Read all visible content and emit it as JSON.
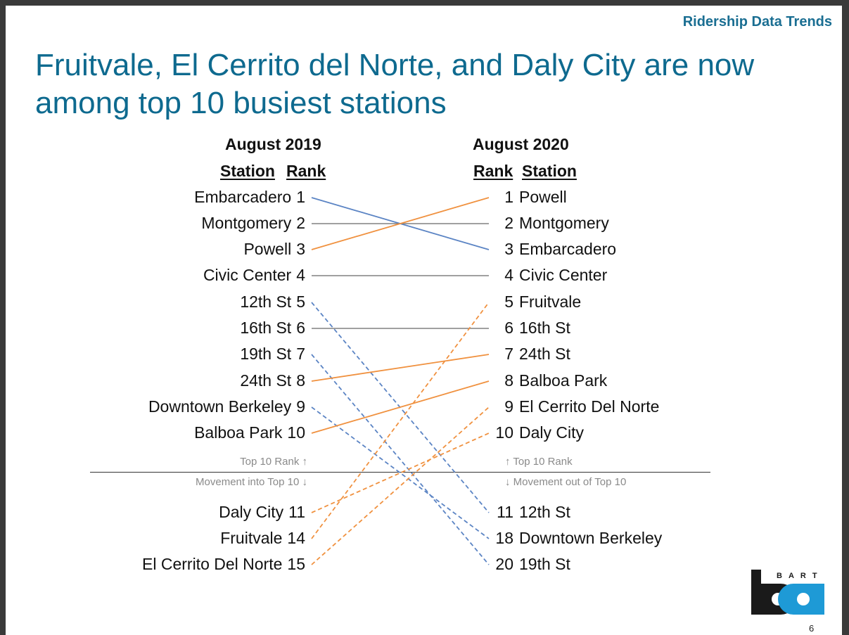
{
  "header": {
    "section_tag": "Ridership Data Trends",
    "title": "Fruitvale, El Cerrito del Norte, and Daly City are now among top 10 busiest stations"
  },
  "footer": {
    "logo_text": "BART",
    "page_number": "6"
  },
  "colors": {
    "title": "#0e6a8f",
    "up": "#f0913f",
    "down": "#5b84c4",
    "same": "#808080",
    "logo_black": "#1a1a1a",
    "logo_blue": "#1e9ad6"
  },
  "chart_data": {
    "type": "slope",
    "title": "Fruitvale, El Cerrito del Norte, and Daly City are now among top 10 busiest stations",
    "left": {
      "year_label": "August 2019",
      "station_header": "Station",
      "rank_header": "Rank",
      "rows": [
        {
          "station": "Embarcadero",
          "rank": "1"
        },
        {
          "station": "Montgomery",
          "rank": "2"
        },
        {
          "station": "Powell",
          "rank": "3"
        },
        {
          "station": "Civic Center",
          "rank": "4"
        },
        {
          "station": "12th St",
          "rank": "5"
        },
        {
          "station": "16th St",
          "rank": "6"
        },
        {
          "station": "19th St",
          "rank": "7"
        },
        {
          "station": "24th St",
          "rank": "8"
        },
        {
          "station": "Downtown Berkeley",
          "rank": "9"
        },
        {
          "station": "Balboa Park",
          "rank": "10"
        },
        {
          "station": "Daly City",
          "rank": "11"
        },
        {
          "station": "Fruitvale",
          "rank": "14"
        },
        {
          "station": "El Cerrito Del Norte",
          "rank": "15"
        }
      ],
      "note_top": "Top 10 Rank ↑",
      "note_bottom": "Movement into Top 10 ↓"
    },
    "right": {
      "year_label": "August 2020",
      "rank_header": "Rank",
      "station_header": "Station",
      "rows": [
        {
          "rank": "1",
          "station": "Powell"
        },
        {
          "rank": "2",
          "station": "Montgomery"
        },
        {
          "rank": "3",
          "station": "Embarcadero"
        },
        {
          "rank": "4",
          "station": "Civic Center"
        },
        {
          "rank": "5",
          "station": "Fruitvale"
        },
        {
          "rank": "6",
          "station": "16th St"
        },
        {
          "rank": "7",
          "station": "24th St"
        },
        {
          "rank": "8",
          "station": "Balboa Park"
        },
        {
          "rank": "9",
          "station": "El Cerrito Del Norte"
        },
        {
          "rank": "10",
          "station": "Daly City"
        },
        {
          "rank": "11",
          "station": "12th St"
        },
        {
          "rank": "18",
          "station": "Downtown Berkeley"
        },
        {
          "rank": "20",
          "station": "19th St"
        }
      ],
      "note_top": "↑ Top 10 Rank",
      "note_bottom": "↓ Movement out of Top 10"
    },
    "links": [
      {
        "station": "Embarcadero",
        "rank_2019": 1,
        "rank_2020": 3,
        "direction": "down",
        "style": "solid"
      },
      {
        "station": "Montgomery",
        "rank_2019": 2,
        "rank_2020": 2,
        "direction": "same",
        "style": "solid"
      },
      {
        "station": "Powell",
        "rank_2019": 3,
        "rank_2020": 1,
        "direction": "up",
        "style": "solid"
      },
      {
        "station": "Civic Center",
        "rank_2019": 4,
        "rank_2020": 4,
        "direction": "same",
        "style": "solid"
      },
      {
        "station": "12th St",
        "rank_2019": 5,
        "rank_2020": 11,
        "direction": "down",
        "style": "dashed"
      },
      {
        "station": "16th St",
        "rank_2019": 6,
        "rank_2020": 6,
        "direction": "same",
        "style": "solid"
      },
      {
        "station": "19th St",
        "rank_2019": 7,
        "rank_2020": 20,
        "direction": "down",
        "style": "dashed"
      },
      {
        "station": "24th St",
        "rank_2019": 8,
        "rank_2020": 7,
        "direction": "up",
        "style": "solid"
      },
      {
        "station": "Downtown Berkeley",
        "rank_2019": 9,
        "rank_2020": 18,
        "direction": "down",
        "style": "dashed"
      },
      {
        "station": "Balboa Park",
        "rank_2019": 10,
        "rank_2020": 8,
        "direction": "up",
        "style": "solid"
      },
      {
        "station": "Daly City",
        "rank_2019": 11,
        "rank_2020": 10,
        "direction": "up",
        "style": "dashed"
      },
      {
        "station": "Fruitvale",
        "rank_2019": 14,
        "rank_2020": 5,
        "direction": "up",
        "style": "dashed"
      },
      {
        "station": "El Cerrito Del Norte",
        "rank_2019": 15,
        "rank_2020": 9,
        "direction": "up",
        "style": "dashed"
      }
    ]
  }
}
